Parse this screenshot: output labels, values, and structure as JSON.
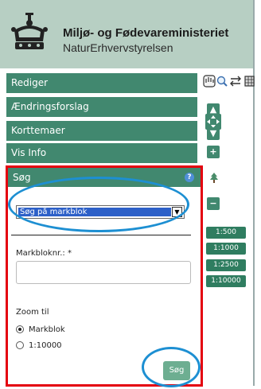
{
  "header": {
    "ministry": "Miljø- og Fødevareministeriet",
    "agency": "NaturErhvervstyrelsen"
  },
  "panels": [
    {
      "label": "Rediger"
    },
    {
      "label": "Ændringsforslag"
    },
    {
      "label": "Korttemaer"
    },
    {
      "label": "Vis Info"
    }
  ],
  "search": {
    "title": "Søg",
    "help_icon": "?",
    "select_value": "Søg på markblok",
    "field_label": "Markbloknr.: *",
    "field_value": "",
    "zoom_label": "Zoom til",
    "option_1": "Markblok",
    "option_2": "1:10000",
    "button": "Søg"
  },
  "map_tools": {
    "scales": [
      "1:500",
      "1:1000",
      "1:2500",
      "1:10000"
    ]
  },
  "colors": {
    "header_bg": "#b7cfc3",
    "panel_green": "#41886f",
    "highlight_red": "#e4000f",
    "highlight_blue": "#1d8fd2"
  }
}
